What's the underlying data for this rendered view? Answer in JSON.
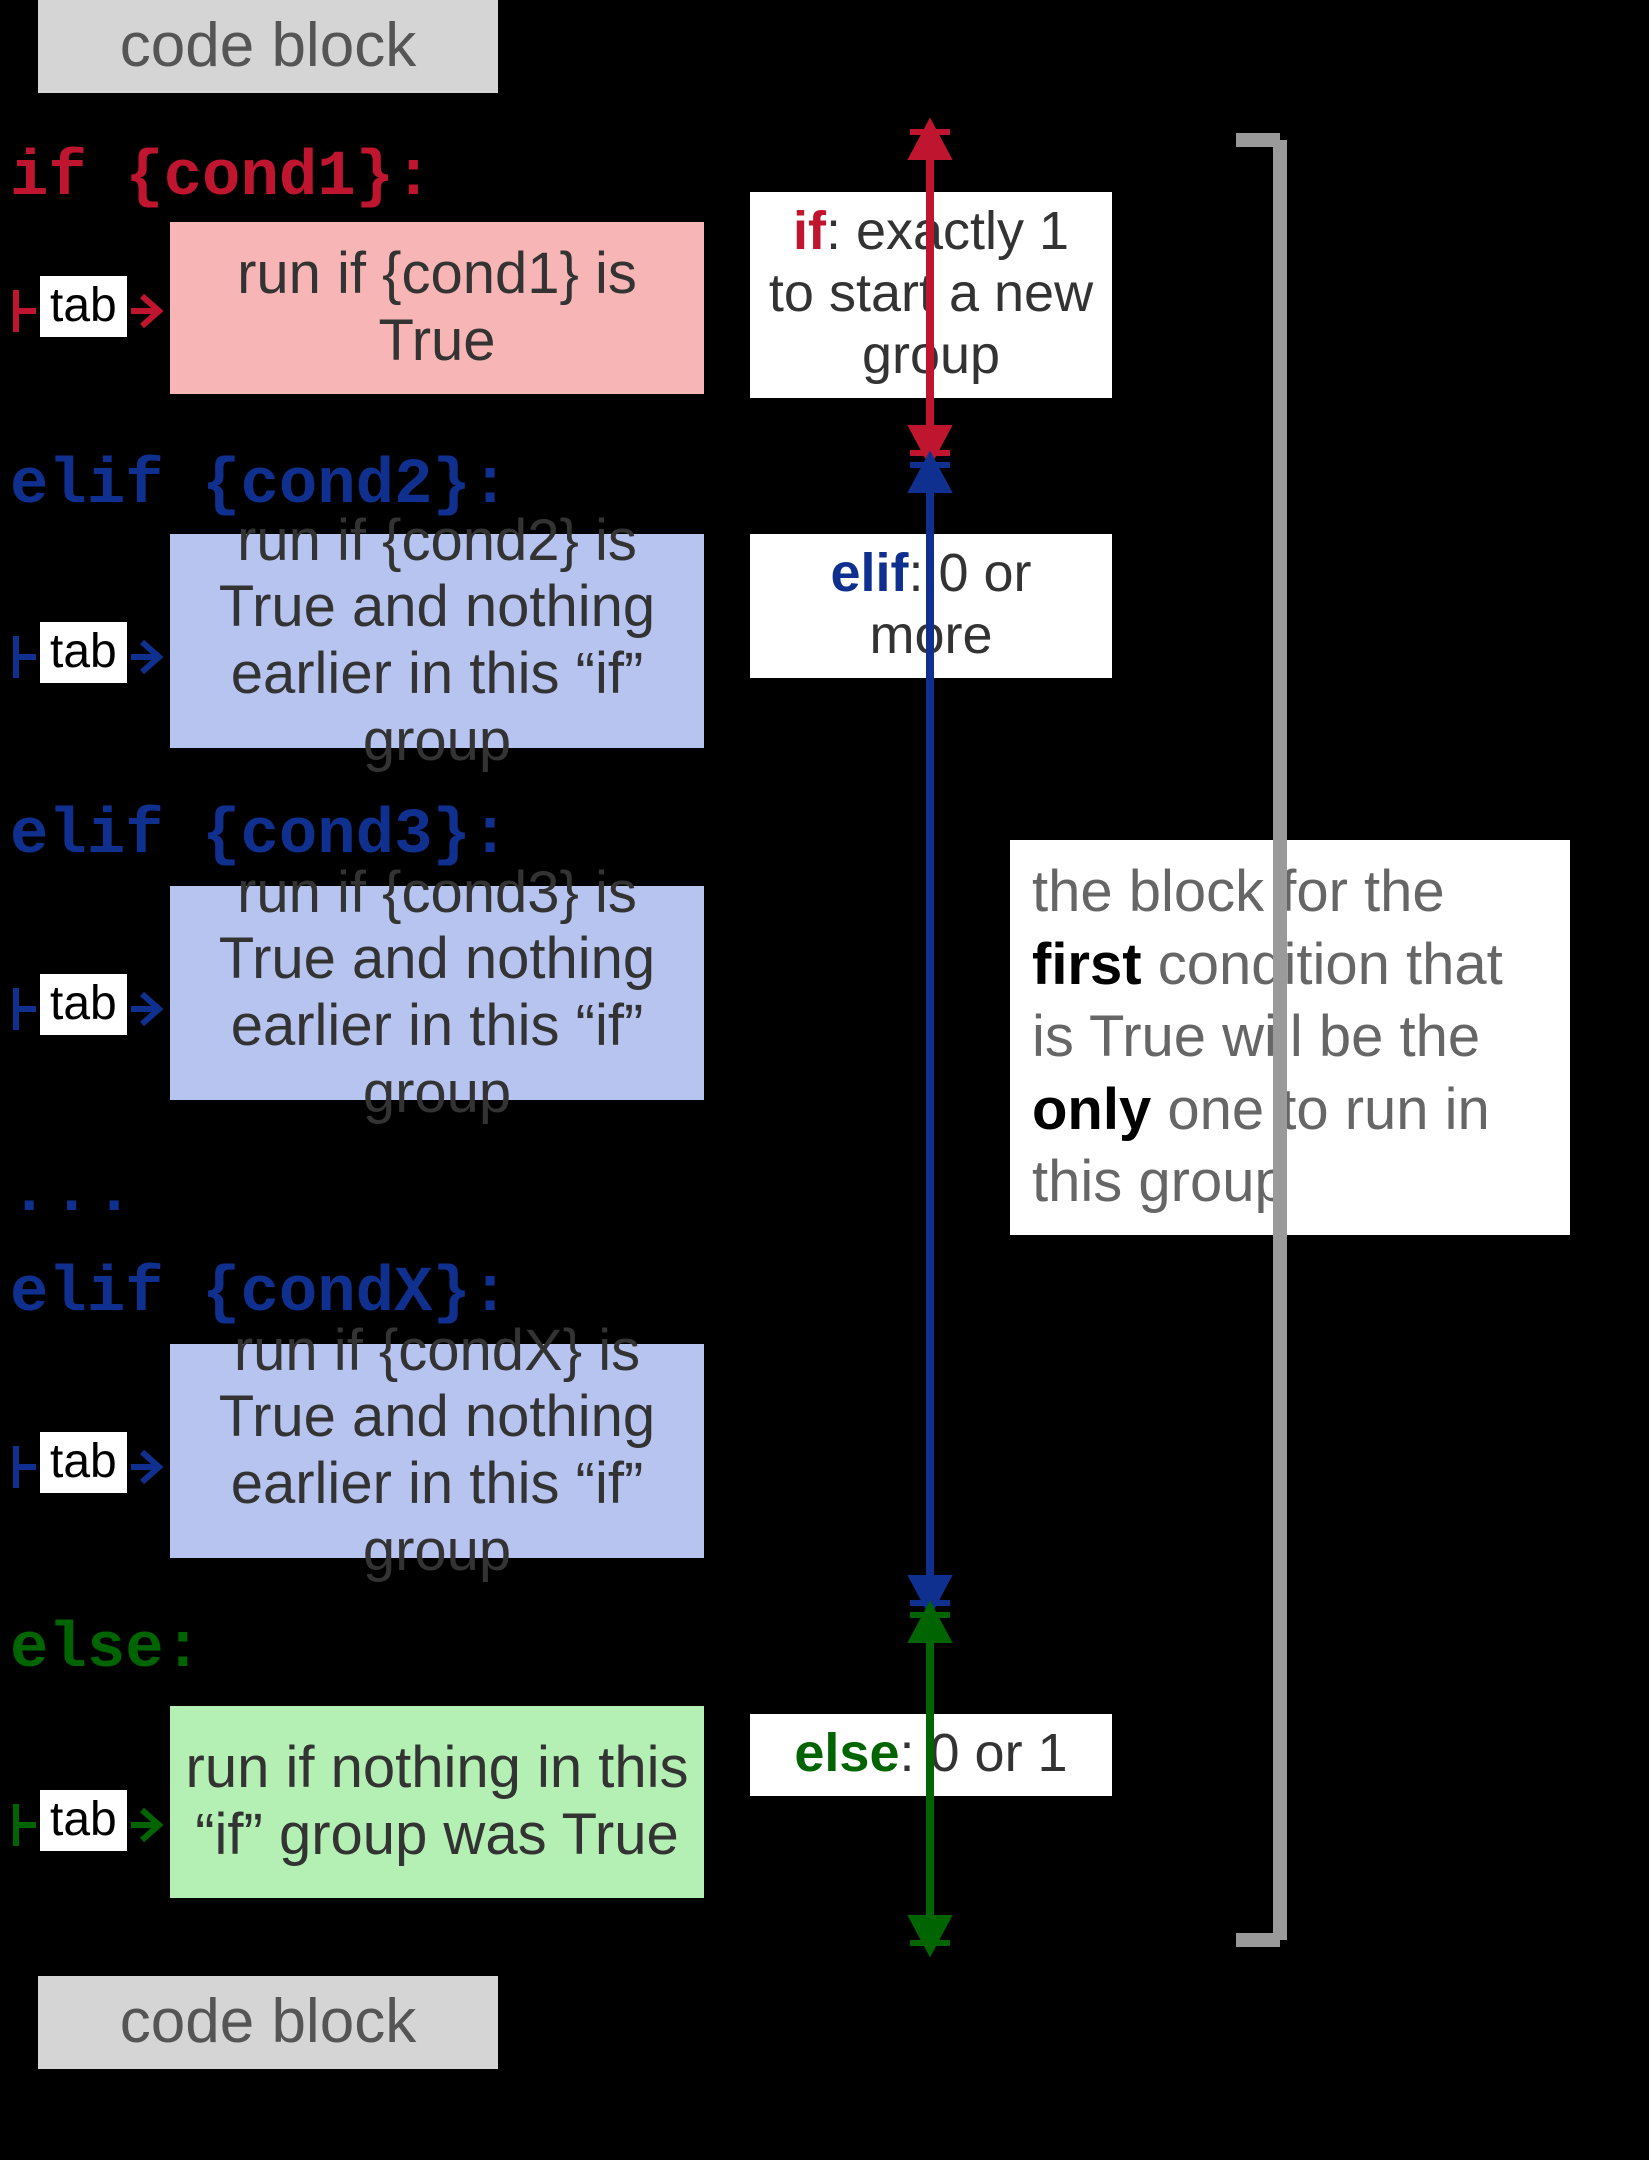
{
  "labels": {
    "codeblock_top": "code block",
    "codeblock_bottom": "code block",
    "tab": "tab"
  },
  "keywords": {
    "if_line": "if {cond1}:",
    "elif2_line": "elif {cond2}:",
    "elif3_line": "elif {cond3}:",
    "dots": "...",
    "elifX_line": "elif {condX}:",
    "else_line": "else:"
  },
  "blocks": {
    "if_body": "run if {cond1} is True",
    "elif2_body": "run if {cond2} is True and nothing earlier in this “if” group",
    "elif3_body": "run if {cond3} is True and nothing earlier in this “if” group",
    "elifX_body": "run if {condX} is True and nothing earlier in this “if” group",
    "else_body": "run if nothing in this “if” group was True"
  },
  "annotations": {
    "if_kw": "if",
    "if_rest": ": exactly 1 to start a new group",
    "elif_kw": "elif",
    "elif_rest": ": 0 or more",
    "else_kw": "else",
    "else_rest": ": 0 or 1"
  },
  "summary": {
    "t1": "the block for the ",
    "b1": "first",
    "t2": " condition that is True will be the ",
    "b2": "only",
    "t3": " one to run in this group"
  },
  "colors": {
    "if": "#c0152f",
    "elif": "#10308f",
    "else": "#006400",
    "bracket": "#9a9a9a"
  }
}
